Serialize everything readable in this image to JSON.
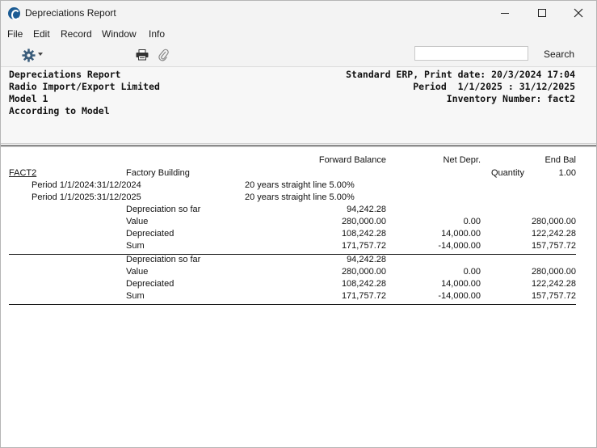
{
  "window": {
    "title": "Depreciations Report"
  },
  "menu": [
    "File",
    "Edit",
    "Record",
    "Window",
    "Info"
  ],
  "toolbar": {
    "search_placeholder": "",
    "search_label": "Search"
  },
  "header": {
    "left": [
      "Depreciations Report",
      "Radio Import/Export Limited",
      "Model 1",
      "According to Model"
    ],
    "right": [
      "Standard ERP, Print date: 20/3/2024 17:04",
      "Period  1/1/2025 : 31/12/2025",
      "Inventory Number: fact2"
    ]
  },
  "report": {
    "columns": {
      "forward": "Forward Balance",
      "net": "Net Depr.",
      "end": "End Bal"
    },
    "asset": {
      "code": "FACT2",
      "name": "Factory Building",
      "qty_label": "Quantity",
      "qty_value": "1.00"
    },
    "periods": [
      {
        "label": "Period 1/1/2024:31/12/2024",
        "method": "20 years straight line 5.00%"
      },
      {
        "label": "Period 1/1/2025:31/12/2025",
        "method": "20 years straight line 5.00%"
      }
    ],
    "asset_rows": [
      {
        "label": "Depreciation so far",
        "forward": "94,242.28",
        "net": "",
        "end": ""
      },
      {
        "label": "Value",
        "forward": "280,000.00",
        "net": "0.00",
        "end": "280,000.00"
      },
      {
        "label": "Depreciated",
        "forward": "108,242.28",
        "net": "14,000.00",
        "end": "122,242.28"
      },
      {
        "label": "Sum",
        "forward": "171,757.72",
        "net": "-14,000.00",
        "end": "157,757.72"
      }
    ],
    "total_rows": [
      {
        "label": "Depreciation so far",
        "forward": "94,242.28",
        "net": "",
        "end": ""
      },
      {
        "label": "Value",
        "forward": "280,000.00",
        "net": "0.00",
        "end": "280,000.00"
      },
      {
        "label": "Depreciated",
        "forward": "108,242.28",
        "net": "14,000.00",
        "end": "122,242.28"
      },
      {
        "label": "Sum",
        "forward": "171,757.72",
        "net": "-14,000.00",
        "end": "157,757.72"
      }
    ]
  }
}
